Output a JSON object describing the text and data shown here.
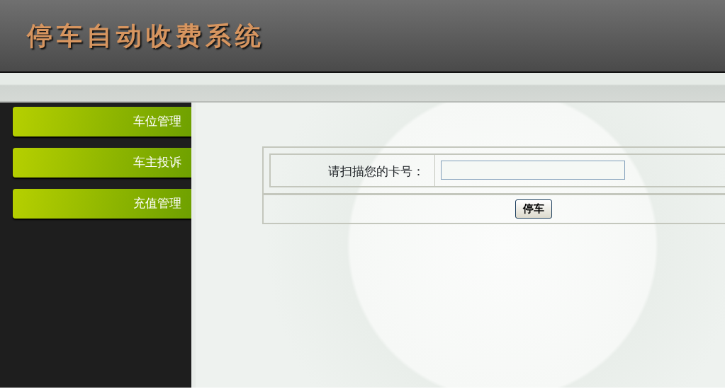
{
  "header": {
    "title": "停车自动收费系统"
  },
  "sidebar": {
    "items": [
      {
        "label": "车位管理"
      },
      {
        "label": "车主投诉"
      },
      {
        "label": "充值管理"
      }
    ]
  },
  "form": {
    "label": "请扫描您的卡号：",
    "submit": "停车"
  }
}
